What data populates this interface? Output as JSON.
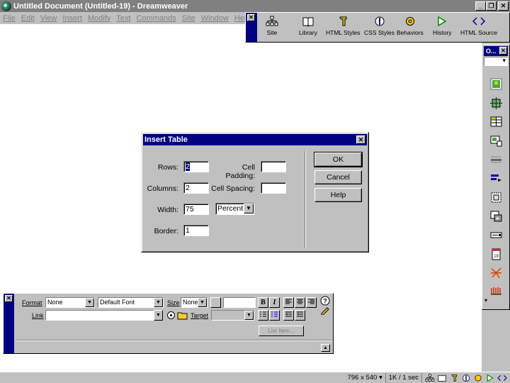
{
  "window": {
    "title": "Untitled Document (Untitled-19) - Dreamweaver",
    "buttons": {
      "minimize": "_",
      "maximize": "❐",
      "close": "✕"
    }
  },
  "menubar": {
    "items": [
      {
        "label": "File"
      },
      {
        "label": "Edit"
      },
      {
        "label": "View"
      },
      {
        "label": "Insert"
      },
      {
        "label": "Modify"
      },
      {
        "label": "Text"
      },
      {
        "label": "Commands"
      },
      {
        "label": "Site"
      },
      {
        "label": "Window"
      },
      {
        "label": "Help"
      }
    ]
  },
  "launcher": {
    "close": "✕",
    "items": [
      {
        "label": "Site",
        "icon": "site-icon"
      },
      {
        "label": "Library",
        "icon": "library-icon"
      },
      {
        "label": "HTML Styles",
        "icon": "html-styles-icon"
      },
      {
        "label": "CSS Styles",
        "icon": "css-styles-icon"
      },
      {
        "label": "Behaviors",
        "icon": "behaviors-icon"
      },
      {
        "label": "History",
        "icon": "history-icon"
      },
      {
        "label": "HTML Source",
        "icon": "html-source-icon"
      }
    ]
  },
  "objects_palette": {
    "title": "O...",
    "close": "✕",
    "icons": [
      "insert-image-icon",
      "insert-rollover-icon",
      "insert-table-icon",
      "insert-layer-icon",
      "insert-hr-icon",
      "insert-navbar-icon",
      "insert-layer-box-icon",
      "insert-flash-icon",
      "insert-form-icon",
      "insert-date-icon",
      "insert-fireworks-icon",
      "insert-email-icon"
    ]
  },
  "insert_table_dialog": {
    "title": "Insert Table",
    "close": "✕",
    "rows_label": "Rows:",
    "rows_value": "2",
    "columns_label": "Columns:",
    "columns_value": "2",
    "width_label": "Width:",
    "width_value": "75",
    "width_unit": "Percent",
    "border_label": "Border:",
    "border_value": "1",
    "cell_padding_label": "Cell Padding:",
    "cell_padding_value": "",
    "cell_spacing_label": "Cell Spacing:",
    "cell_spacing_value": "",
    "ok_label": "OK",
    "cancel_label": "Cancel",
    "help_label": "Help"
  },
  "properties": {
    "close": "✕",
    "format_label": "Format",
    "format_value": "None",
    "font_value": "Default Font",
    "size_label": "Size",
    "size_value": "None",
    "link_label": "Link",
    "target_label": "Target",
    "bold_label": "B",
    "italic_label": "I",
    "list_item_label": "List Item..."
  },
  "statusbar": {
    "window_size": "796 x 540",
    "download": "1K / 1 sec"
  }
}
